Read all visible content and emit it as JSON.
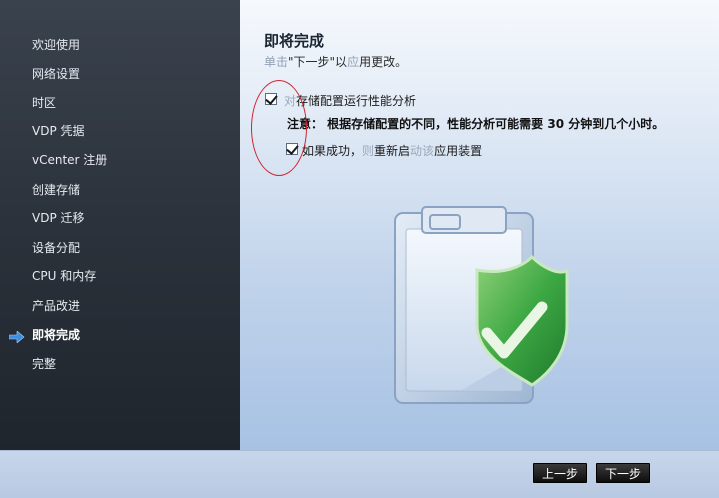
{
  "sidebar": {
    "items": [
      {
        "label": "欢迎使用"
      },
      {
        "label": "网络设置"
      },
      {
        "label": "时区"
      },
      {
        "label": "VDP 凭据"
      },
      {
        "label": "vCenter 注册"
      },
      {
        "label": "创建存储"
      },
      {
        "label": "VDP 迁移"
      },
      {
        "label": "设备分配"
      },
      {
        "label": "CPU 和内存"
      },
      {
        "label": "产品改进"
      },
      {
        "label": "即将完成",
        "active": true
      },
      {
        "label": "完整"
      }
    ],
    "active_icon": "arrow-right-icon"
  },
  "main": {
    "title": "即将完成",
    "subtitle": {
      "faint": "单击",
      "text": "\"下一步\"以",
      "faint2": "应",
      "end": "用更改。"
    },
    "option_perf": {
      "checked": true,
      "label_faint": "对",
      "label": "存储配置运行性能分析"
    },
    "note": "注意：  根据存储配置的不同，性能分析可能需要 30 分钟到几个小时。",
    "option_restart": {
      "checked": true,
      "label": "如果成功，",
      "label_faint": "则",
      "label_mid": "重新启",
      "label_faint2": "动该",
      "label_end": "应用装置"
    },
    "illustration": "clipboard-shield-check-icon"
  },
  "footer": {
    "back_label": "上一步",
    "next_label": "下一步"
  },
  "colors": {
    "sidebar_bg": "#2b323b",
    "accent_arrow": "#3d8ee0",
    "annotation": "#d1262e",
    "shield_green": "#3da843"
  }
}
